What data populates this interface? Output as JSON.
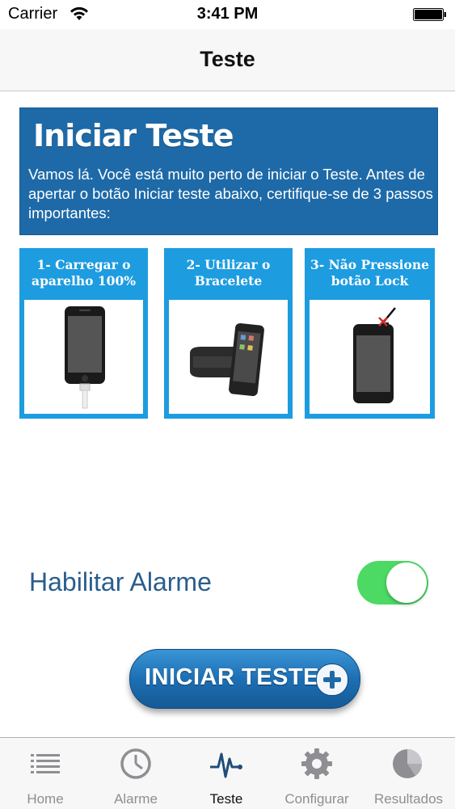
{
  "status_bar": {
    "carrier": "Carrier",
    "time": "3:41 PM"
  },
  "nav": {
    "title": "Teste"
  },
  "banner": {
    "title": "Iniciar Teste",
    "text": "Vamos lá. Você está muito perto de iniciar o Teste. Antes de apertar o botão Iniciar teste abaixo, certifique-se de 3 passos importantes:"
  },
  "steps": [
    {
      "label": "1- Carregar o aparelho 100%",
      "icon": "phone-charging-icon"
    },
    {
      "label": "2- Utilizar o Bracelete",
      "icon": "armband-icon"
    },
    {
      "label": "3- Não Pressione botão Lock",
      "icon": "phone-lock-icon"
    }
  ],
  "alarm": {
    "label": "Habilitar Alarme",
    "enabled": true
  },
  "start_button": {
    "label": "INICIAR TESTE"
  },
  "tabs": [
    {
      "label": "Home",
      "icon": "list-icon"
    },
    {
      "label": "Alarme",
      "icon": "clock-icon"
    },
    {
      "label": "Teste",
      "icon": "heartbeat-icon",
      "active": true
    },
    {
      "label": "Configurar",
      "icon": "gear-icon"
    },
    {
      "label": "Resultados",
      "icon": "pie-chart-icon"
    }
  ],
  "colors": {
    "banner": "#1e6aa8",
    "step": "#1d9ce0",
    "toggle_on": "#4cd964",
    "alarm_label": "#2a5d8c"
  }
}
